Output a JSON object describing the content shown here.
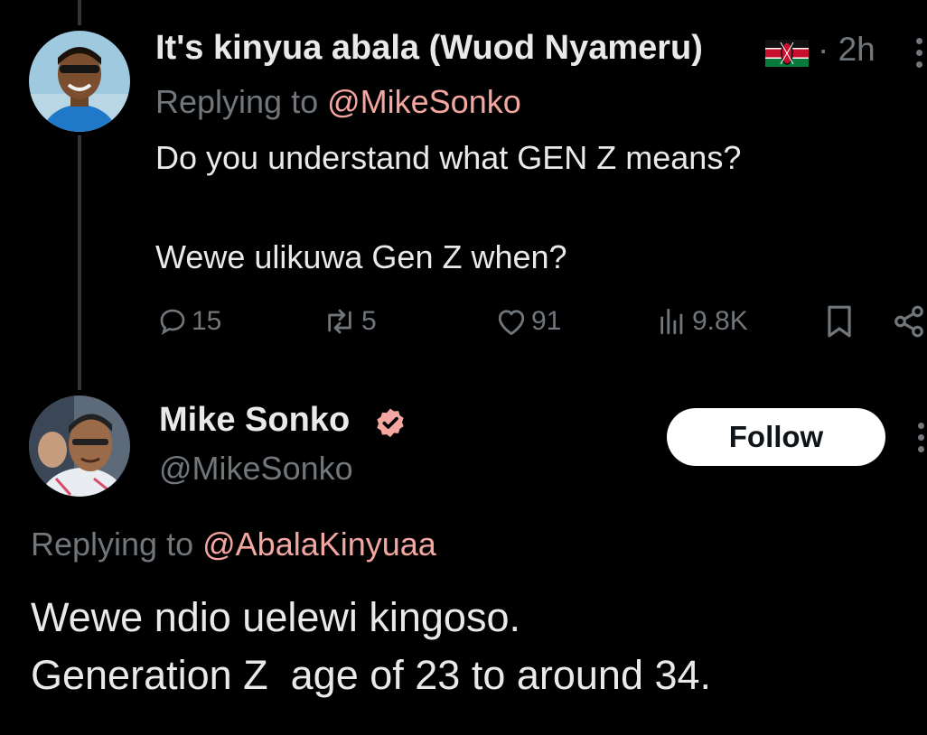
{
  "tweet1": {
    "author_name": "It's kinyua abala (Wuod Nyameru)",
    "flag_icon": "kenya-flag-icon",
    "time": "· 2h",
    "replying_prefix": "Replying to ",
    "replying_to": "@MikeSonko",
    "text_line1": "Do you understand what GEN Z means?",
    "text_line2": "Wewe ulikuwa Gen Z when?",
    "actions": {
      "replies": "15",
      "reposts": "5",
      "likes": "91",
      "views": "9.8K"
    }
  },
  "tweet2": {
    "author_name": "Mike Sonko",
    "handle": "@MikeSonko",
    "verified_icon": "verified-badge-icon",
    "follow_label": "Follow",
    "replying_prefix": "Replying to ",
    "replying_to": "@AbalaKinyuaa",
    "text_line1": "Wewe ndio uelewi kingoso.",
    "text_line2": "Generation Z  age of 23 to around 34."
  },
  "colors": {
    "background": "#000000",
    "text_primary": "#e7e9ea",
    "text_secondary": "#71767b",
    "mention": "#f4a6a0",
    "verified": "#f4a6a0"
  }
}
